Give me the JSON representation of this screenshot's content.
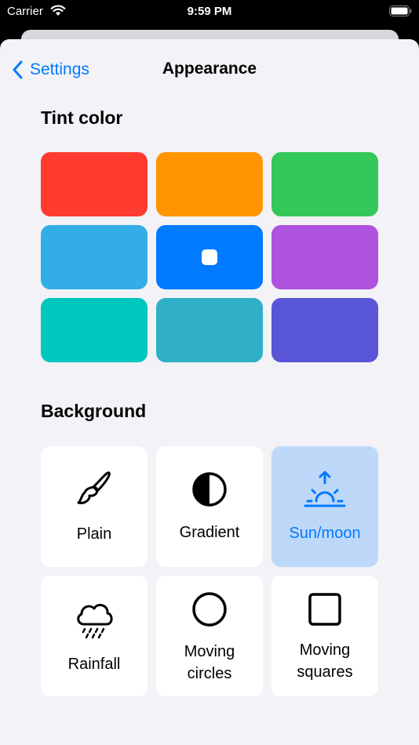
{
  "status_bar": {
    "carrier": "Carrier",
    "time": "9:59 PM"
  },
  "nav": {
    "back_label": "Settings",
    "title": "Appearance"
  },
  "tint": {
    "title": "Tint color",
    "swatches": [
      {
        "color": "#ff3b30",
        "selected": false
      },
      {
        "color": "#ff9500",
        "selected": false
      },
      {
        "color": "#34c759",
        "selected": false
      },
      {
        "color": "#32ade6",
        "selected": false
      },
      {
        "color": "#007aff",
        "selected": true
      },
      {
        "color": "#af52de",
        "selected": false
      },
      {
        "color": "#00c7be",
        "selected": false
      },
      {
        "color": "#30b0c7",
        "selected": false
      },
      {
        "color": "#5856d6",
        "selected": false
      }
    ]
  },
  "background": {
    "title": "Background",
    "options": [
      {
        "label": "Plain",
        "icon": "paintbrush-icon",
        "selected": false
      },
      {
        "label": "Gradient",
        "icon": "half-circle-icon",
        "selected": false
      },
      {
        "label": "Sun/moon",
        "icon": "sunrise-icon",
        "selected": true
      },
      {
        "label": "Rainfall",
        "icon": "cloud-rain-icon",
        "selected": false
      },
      {
        "label": "Moving\ncircles",
        "icon": "circle-icon",
        "selected": false
      },
      {
        "label": "Moving\nsquares",
        "icon": "square-icon",
        "selected": false
      }
    ]
  },
  "colors": {
    "accent": "#007aff",
    "selected_tile": "#bed8fa",
    "sheet": "#f2f2f7"
  }
}
